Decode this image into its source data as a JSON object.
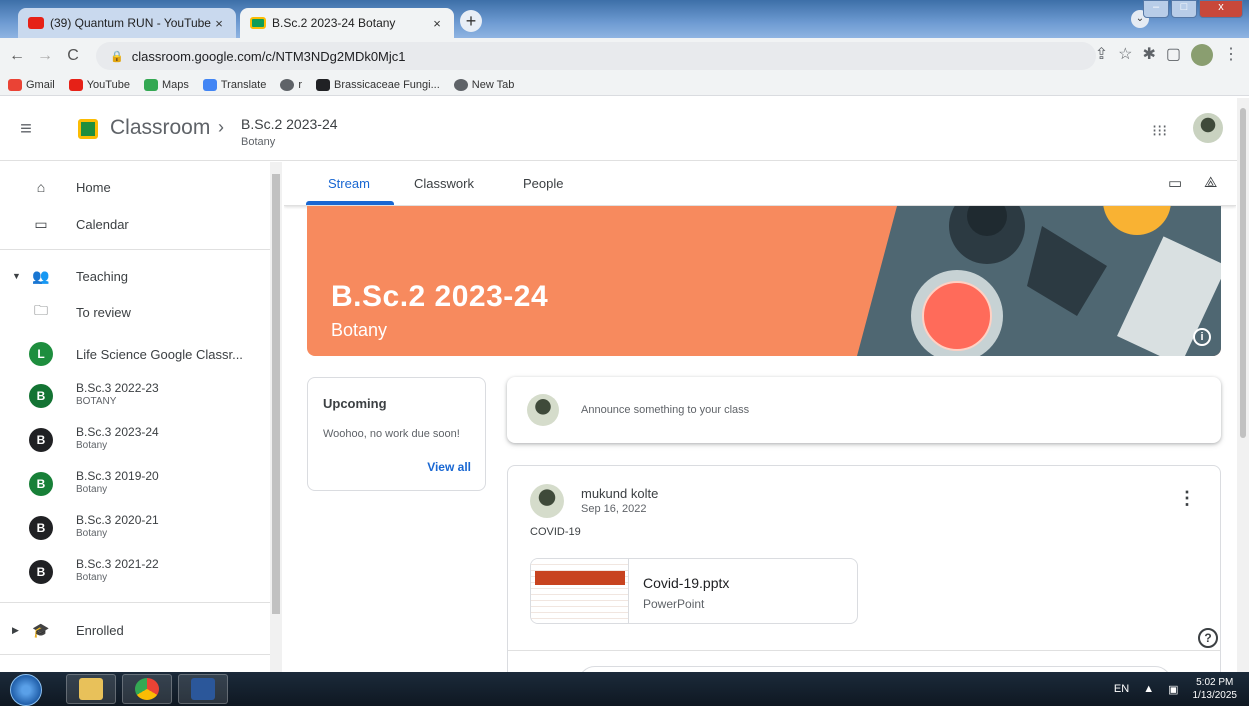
{
  "browser": {
    "tabs": [
      {
        "title": "(39) Quantum RUN - YouTube",
        "close": "×",
        "favicon_color": "#e62117"
      },
      {
        "title": "B.Sc.2 2023-24 Botany",
        "close": "×",
        "favicon_color": "#0f9d58"
      }
    ],
    "new_tab": "+",
    "url": "classroom.google.com/c/NTM3NDg2MDk0Mjc1",
    "bookmarks": [
      {
        "label": "Gmail",
        "color": "#ea4335"
      },
      {
        "label": "YouTube",
        "color": "#e62117"
      },
      {
        "label": "Maps",
        "color": "#34a853"
      },
      {
        "label": "Translate",
        "color": "#4285f4"
      },
      {
        "label": "r",
        "color": "#5f6368"
      },
      {
        "label": "Brassicaceae Fungi...",
        "color": "#202124"
      },
      {
        "label": "New Tab",
        "color": "#5f6368"
      }
    ]
  },
  "header": {
    "app_name": "Classroom",
    "breadcrumb_title": "B.Sc.2 2023-24",
    "breadcrumb_sub": "Botany"
  },
  "sidebar": {
    "home": "Home",
    "calendar": "Calendar",
    "teaching": "Teaching",
    "to_review": "To review",
    "classes": [
      {
        "letter": "L",
        "name": "Life Science Google Classr...",
        "sub": "",
        "color": "#1e8e3e"
      },
      {
        "letter": "B",
        "name": "B.Sc.3 2022-23",
        "sub": "BOTANY",
        "color": "#137333"
      },
      {
        "letter": "B",
        "name": "B.Sc.3 2023-24",
        "sub": "Botany",
        "color": "#202124"
      },
      {
        "letter": "B",
        "name": "B.Sc.3 2019-20",
        "sub": "Botany",
        "color": "#188038"
      },
      {
        "letter": "B",
        "name": "B.Sc.3 2020-21",
        "sub": "Botany",
        "color": "#202124"
      },
      {
        "letter": "B",
        "name": "B.Sc.3 2021-22",
        "sub": "Botany",
        "color": "#202124"
      }
    ],
    "enrolled": "Enrolled"
  },
  "main": {
    "tabs": [
      "Stream",
      "Classwork",
      "People"
    ],
    "banner_title": "B.Sc.2 2023-24",
    "banner_sub": "Botany",
    "banner_color": "#f78a5e",
    "upcoming_title": "Upcoming",
    "upcoming_text": "Woohoo, no work due soon!",
    "view_all": "View all",
    "announce_placeholder": "Announce something to your class",
    "post": {
      "author": "mukund kolte",
      "date": "Sep 16, 2022",
      "body": "COVID-19",
      "attachment_name": "Covid-19.pptx",
      "attachment_type": "PowerPoint"
    }
  },
  "taskbar": {
    "lang": "EN",
    "time": "5:02 PM",
    "date": "1/13/2025"
  }
}
